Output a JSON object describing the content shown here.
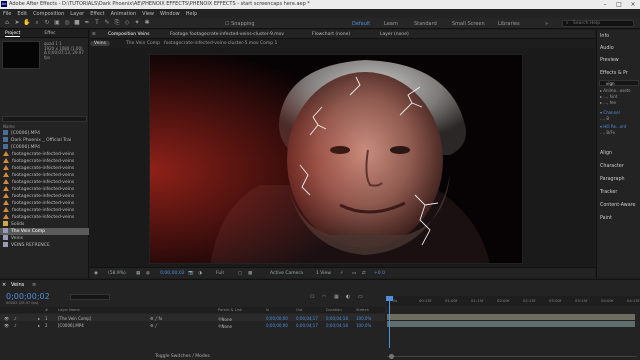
{
  "app": {
    "title": "Adobe After Effects - D:\\TUTORIALS\\Dark Phoenix\\AE\\PHENOIX EFFECTS\\PHENOIX EFFECTS - start screencaps here.aep *",
    "logo": "Ae"
  },
  "menu": [
    "File",
    "Edit",
    "Composition",
    "Layer",
    "Effect",
    "Animation",
    "View",
    "Window",
    "Help"
  ],
  "toolbar": {
    "snapping_label": "Snapping",
    "workspaces": [
      "Default",
      "Learn",
      "Standard",
      "Small Screen",
      "Libraries"
    ],
    "active_workspace": "Default",
    "search_placeholder": "Search Help"
  },
  "project": {
    "tabs": [
      "Project",
      "Effec"
    ],
    "selected_item": "quad 1 1",
    "meta": [
      "1920 x 1080 (1.00)",
      "Δ 0;00;07;13, 29.97 fps"
    ],
    "column_header": "Name",
    "items": [
      {
        "label": "[C0006].MP4",
        "icon": "vid"
      },
      {
        "label": "Dark Phoenix _ Official Trai",
        "icon": "vid"
      },
      {
        "label": "[C0006].MP4",
        "icon": "vid"
      },
      {
        "label": "footagecrate-infected-veins",
        "icon": "orange"
      },
      {
        "label": "footagecrate-infected-veins",
        "icon": "orange"
      },
      {
        "label": "footagecrate-infected-veins",
        "icon": "orange"
      },
      {
        "label": "footagecrate-infected-veins",
        "icon": "orange"
      },
      {
        "label": "footagecrate-infected-veins",
        "icon": "orange"
      },
      {
        "label": "footagecrate-infected-veins",
        "icon": "orange"
      },
      {
        "label": "footagecrate-infected-veins",
        "icon": "orange"
      },
      {
        "label": "footagecrate-infected-veins",
        "icon": "orange"
      },
      {
        "label": "footagecrate-infected-veins",
        "icon": "orange"
      },
      {
        "label": "footagecrate-infected-veins",
        "icon": "orange"
      },
      {
        "label": "Solids",
        "icon": "folder"
      },
      {
        "label": "The Vein Comp",
        "icon": "comp",
        "selected": true
      },
      {
        "label": "Veins",
        "icon": "comp"
      },
      {
        "label": "VEINS REFRENCE",
        "icon": "comp"
      }
    ],
    "footer_bpc": "8 bpc"
  },
  "viewer": {
    "panel_tabs": [
      {
        "label": "Composition Veins",
        "selected": true
      },
      {
        "label": "Footage footagecrate-infected-veins-cluster-9.mov"
      },
      {
        "label": "Flowchart  (none)"
      },
      {
        "label": "Layer  (none)"
      }
    ],
    "sub_tabs": [
      "Veins",
      "The Vein Comp",
      "footagecrate-infected-veins-cluster-5.mov Comp 1"
    ],
    "footer": {
      "zoom": "(58.9%)",
      "timecode": "0;00;00;02",
      "resolution": "Full",
      "camera": "Active Camera",
      "views": "1 View",
      "exposure": "+0.0"
    }
  },
  "right_panel": {
    "items": [
      "Info",
      "Audio",
      "Preview",
      "Effects & Pr",
      "Align",
      "Character",
      "Paragraph",
      "Tracker",
      "Content-Aware",
      "Paint"
    ],
    "effects_search": "vign",
    "effects_tree": [
      "▸ Anima...esets",
      "  ▸ ..., hint",
      "     ▸ ..., fee",
      "▾ Channel",
      "     ..., B",
      "▾ Hill Re...ent",
      "     ..., B/Fe"
    ]
  },
  "timeline": {
    "tab_label": "Veins",
    "timecode": "0;00;00;02",
    "fps_note": "00002 (29.97 fps)",
    "headers": [
      "#",
      "Layer Name",
      "Parent & Link",
      "In",
      "Out",
      "Duration",
      "Stretch"
    ],
    "layers": [
      {
        "num": "1",
        "name": "[The Vein Comp]",
        "parent": "None",
        "in": "0;00;00;00",
        "out": "0;00;04;17",
        "duration": "0;00;04;18",
        "stretch": "100.0%"
      },
      {
        "num": "2",
        "name": "[C0006].MP4",
        "parent": "None",
        "in": "0;00;00;00",
        "out": "0;00;04;17",
        "duration": "0;00;04;18",
        "stretch": "100.0%"
      }
    ],
    "ruler_ticks": [
      "0s",
      "00:15f",
      "01:00f",
      "01:15f",
      "02:00f",
      "02:15f",
      "03:00f",
      "03:15f",
      "04:00f",
      "04:15f"
    ],
    "toggle_label": "Toggle Switches / Modes",
    "colors": {
      "accent": "#4f8fdc",
      "layer1_bar": "#6e6e5e",
      "layer2_bar": "#5e6e6e"
    }
  }
}
